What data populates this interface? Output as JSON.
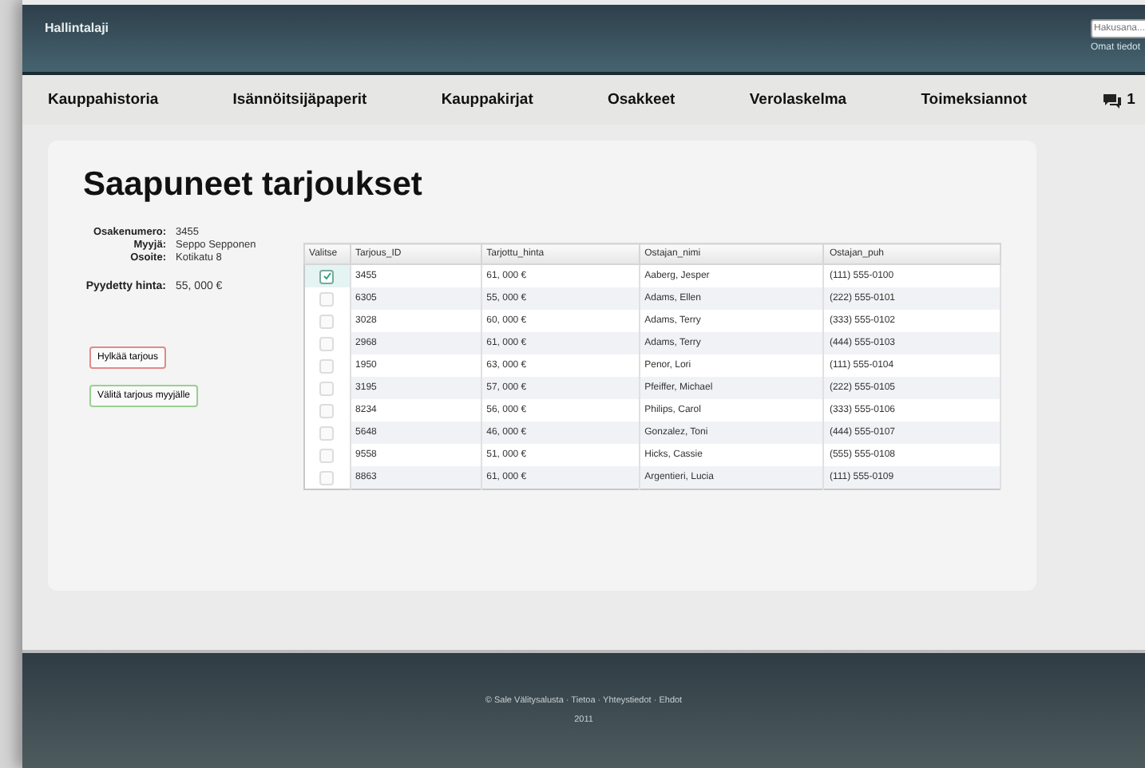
{
  "header": {
    "brand": "Hallintalaji",
    "search": {
      "placeholder": "Hakusana..."
    },
    "user_link": "Omat tiedot"
  },
  "nav": {
    "items": [
      "Kauppahistoria",
      "Isännöitsijäpaperit",
      "Kauppakirjat",
      "Osakkeet",
      "Verolaskelma",
      "Toimeksiannot"
    ],
    "messages": "1"
  },
  "page": {
    "title": "Saapuneet tarjoukset",
    "details": [
      {
        "label": "Osakenumero:",
        "value": "3455"
      },
      {
        "label": "Myyjä:",
        "value": "Seppo Sepponen"
      },
      {
        "label": "Osoite:",
        "value": "Kotikatu 8"
      }
    ],
    "asking": {
      "label": "Pyydetty hinta:",
      "value": "55, 000 €"
    },
    "buttons": [
      {
        "kind": "reject",
        "label": "Hylkää tarjous"
      },
      {
        "kind": "accept",
        "label": "Välitä tarjous myyjälle"
      }
    ]
  },
  "table": {
    "columns": [
      "Valitse",
      "Tarjous_ID",
      "Tarjottu_hinta",
      "Ostajan_nimi",
      "Ostajan_puh"
    ],
    "rows": [
      {
        "selected": true,
        "cells": [
          "",
          "3455",
          "61, 000 €",
          "Aaberg, Jesper",
          "(111) 555-0100"
        ]
      },
      {
        "selected": false,
        "cells": [
          "",
          "6305",
          "55, 000 €",
          "Adams, Ellen",
          "(222) 555-0101"
        ]
      },
      {
        "selected": false,
        "cells": [
          "",
          "3028",
          "60, 000 €",
          "Adams, Terry",
          "(333) 555-0102"
        ]
      },
      {
        "selected": false,
        "cells": [
          "",
          "2968",
          "61, 000 €",
          "Adams, Terry",
          "(444) 555-0103"
        ]
      },
      {
        "selected": false,
        "cells": [
          "",
          "1950",
          "63, 000 €",
          "Penor, Lori",
          "(111) 555-0104"
        ]
      },
      {
        "selected": false,
        "cells": [
          "",
          "3195",
          "57, 000 €",
          "Pfeiffer, Michael",
          "(222) 555-0105"
        ]
      },
      {
        "selected": false,
        "cells": [
          "",
          "8234",
          "56, 000 €",
          "Philips, Carol",
          "(333) 555-0106"
        ]
      },
      {
        "selected": false,
        "cells": [
          "",
          "5648",
          "46, 000 €",
          "Gonzalez, Toni",
          "(444) 555-0107"
        ]
      },
      {
        "selected": false,
        "cells": [
          "",
          "9558",
          "51, 000 €",
          "Hicks, Cassie",
          "(555) 555-0108"
        ]
      },
      {
        "selected": false,
        "cells": [
          "",
          "8863",
          "61, 000 €",
          "Argentieri, Lucia",
          "(111) 555-0109"
        ]
      }
    ]
  },
  "footer": {
    "links": "© Sale Välitysalusta · Tietoa · Yhteystiedot · Ehdot",
    "year": "2011"
  }
}
